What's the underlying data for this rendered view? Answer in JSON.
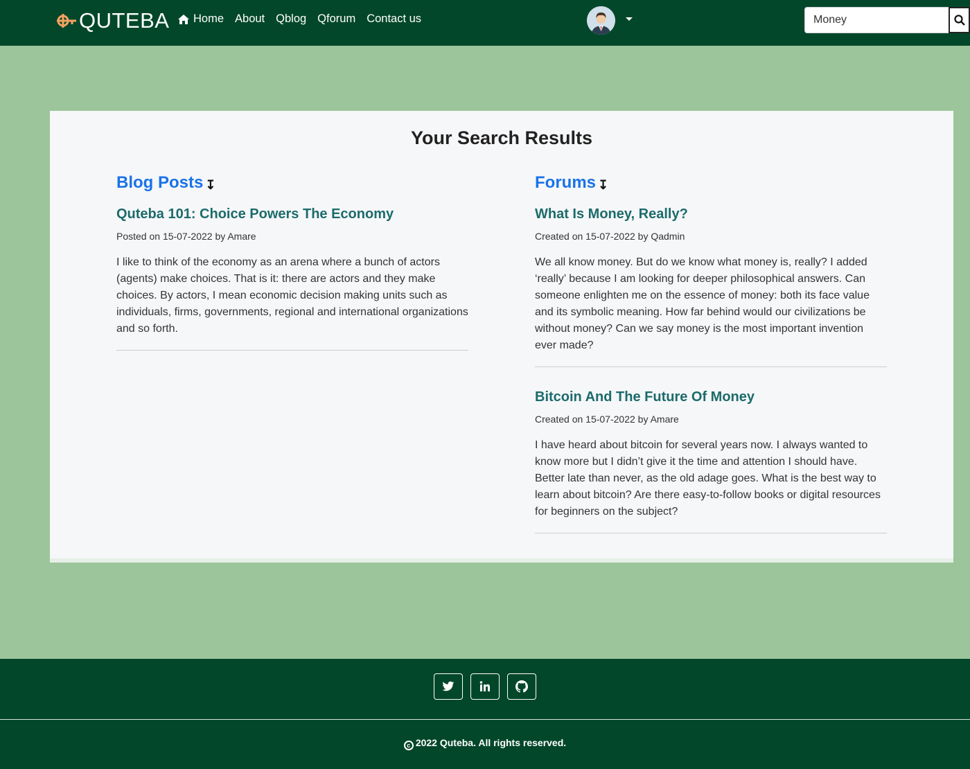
{
  "header": {
    "brand": "QUTEBA",
    "brand_color": "#f4a261",
    "nav": [
      {
        "label": "Home",
        "icon": "home-icon"
      },
      {
        "label": "About"
      },
      {
        "label": "Qblog"
      },
      {
        "label": "Qforum"
      },
      {
        "label": "Contact us"
      }
    ],
    "avatar_icon": "user-avatar",
    "search": {
      "value": "Money",
      "button_icon": "search-icon"
    }
  },
  "colors": {
    "nav_bg": "#03472a",
    "pattern_bg": "#9cc59c",
    "card_bg": "#f6f7f9",
    "section_title": "#1a73e8",
    "post_title": "#1c6b6b"
  },
  "main": {
    "title": "Your Search Results",
    "blog": {
      "heading": "Blog Posts",
      "heading_icon": "arrow-down-icon",
      "posts": [
        {
          "title": "Quteba 101: Choice Powers The Economy",
          "meta": "Posted on 15-07-2022 by Amare",
          "excerpt": "I like to think of the economy as an arena where a bunch of actors (agents) make choices. That is it: there are actors and they make choices. By actors, I mean economic decision making units such as individuals, firms, governments, regional and international organizations and so forth."
        }
      ]
    },
    "forums": {
      "heading": "Forums",
      "heading_icon": "arrow-down-icon",
      "posts": [
        {
          "title": "What Is Money, Really?",
          "meta": "Created on 15-07-2022 by Qadmin",
          "excerpt": "We all know money. But do we know what money is, really? I added ‘really’ because I am looking for deeper philosophical answers. Can someone enlighten me on the essence of money: both its face value and its symbolic meaning. How far behind would our civilizations be without money? Can we say money is the most important invention ever made?"
        },
        {
          "title": "Bitcoin And The Future Of Money",
          "meta": "Created on 15-07-2022 by Amare",
          "excerpt": "I have heard about bitcoin for several years now. I always wanted to know more but I didn’t give it the time and attention I should have. Better late than never, as the old adage goes. What is the best way to learn about bitcoin? Are there easy-to-follow books or digital resources for beginners on the subject?"
        }
      ]
    }
  },
  "footer": {
    "social": [
      {
        "icon": "twitter-icon"
      },
      {
        "icon": "linkedin-icon"
      },
      {
        "icon": "github-icon"
      }
    ],
    "copyright": "2022 Quteba. All rights reserved."
  }
}
